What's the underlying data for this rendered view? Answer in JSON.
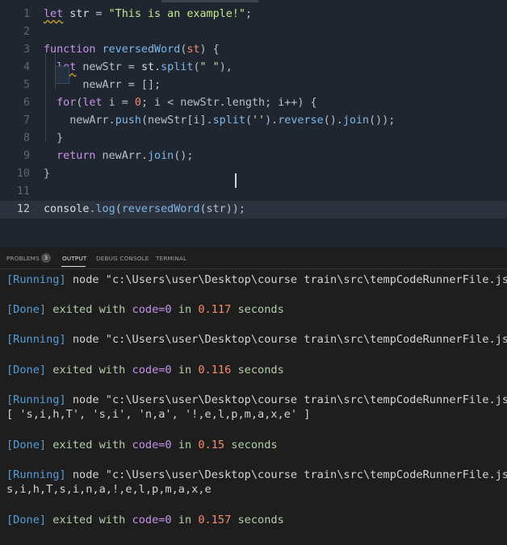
{
  "editor": {
    "lines": [
      {
        "no": "1",
        "tokens": [
          [
            "kw",
            "let"
          ],
          [
            "id",
            " "
          ],
          [
            "id",
            "str"
          ],
          [
            "pc",
            " = "
          ],
          [
            "str",
            "\"This is an example!\""
          ],
          [
            "pc",
            ";"
          ]
        ]
      },
      {
        "no": "2",
        "tokens": []
      },
      {
        "no": "3",
        "tokens": [
          [
            "kw",
            "function"
          ],
          [
            "pc",
            " "
          ],
          [
            "fn",
            "reversedWord"
          ],
          [
            "pc",
            "("
          ],
          [
            "num",
            "st"
          ],
          [
            "pc",
            ") {"
          ]
        ]
      },
      {
        "no": "4",
        "tokens": [
          [
            "pc",
            "  "
          ],
          [
            "kw",
            "let"
          ],
          [
            "pc",
            " newStr = "
          ],
          [
            "id",
            "st"
          ],
          [
            "pc",
            "."
          ],
          [
            "fn",
            "split"
          ],
          [
            "pc",
            "("
          ],
          [
            "str",
            "\" \""
          ],
          [
            "pc",
            "),"
          ]
        ]
      },
      {
        "no": "5",
        "tokens": [
          [
            "pc",
            "      newArr = [];"
          ]
        ]
      },
      {
        "no": "6",
        "tokens": [
          [
            "pc",
            "  "
          ],
          [
            "kw",
            "for"
          ],
          [
            "pc",
            "("
          ],
          [
            "kw",
            "let"
          ],
          [
            "pc",
            " i = "
          ],
          [
            "num",
            "0"
          ],
          [
            "pc",
            "; i < newStr.length; i++) {"
          ]
        ]
      },
      {
        "no": "7",
        "tokens": [
          [
            "pc",
            "    newArr."
          ],
          [
            "fn",
            "push"
          ],
          [
            "pc",
            "(newStr[i]."
          ],
          [
            "fn",
            "split"
          ],
          [
            "pc",
            "("
          ],
          [
            "str",
            "''"
          ],
          [
            "pc",
            ")."
          ],
          [
            "fn",
            "reverse"
          ],
          [
            "pc",
            "()."
          ],
          [
            "fn",
            "join"
          ],
          [
            "pc",
            "());"
          ]
        ]
      },
      {
        "no": "8",
        "tokens": [
          [
            "pc",
            "  }"
          ]
        ]
      },
      {
        "no": "9",
        "tokens": [
          [
            "pc",
            "  "
          ],
          [
            "kw",
            "return"
          ],
          [
            "pc",
            " newArr."
          ],
          [
            "fn",
            "join"
          ],
          [
            "pc",
            "();"
          ]
        ]
      },
      {
        "no": "10",
        "tokens": [
          [
            "pc",
            "}"
          ]
        ]
      },
      {
        "no": "11",
        "tokens": []
      },
      {
        "no": "12",
        "tokens": [
          [
            "id",
            "console"
          ],
          [
            "pc",
            "."
          ],
          [
            "fn",
            "log"
          ],
          [
            "pc",
            "("
          ],
          [
            "fn",
            "reversedWord"
          ],
          [
            "pc",
            "(str));"
          ]
        ]
      }
    ]
  },
  "panel": {
    "tabs": [
      {
        "label": "PROBLEMS",
        "badge": "3"
      },
      {
        "label": "OUTPUT"
      },
      {
        "label": "DEBUG CONSOLE"
      },
      {
        "label": "TERMINAL"
      }
    ],
    "output": [
      {
        "kind": "running",
        "prefix": "[Running]",
        "text": " node \"c:\\Users\\user\\Desktop\\course train\\src\\tempCodeRunnerFile.js\""
      },
      {
        "kind": "blank"
      },
      {
        "kind": "done",
        "prefix": "[Done]",
        "a": " exited with ",
        "code": "code=0",
        "b": " in ",
        "secs": "0.117",
        "c": " seconds"
      },
      {
        "kind": "blank"
      },
      {
        "kind": "running",
        "prefix": "[Running]",
        "text": " node \"c:\\Users\\user\\Desktop\\course train\\src\\tempCodeRunnerFile.js\""
      },
      {
        "kind": "blank"
      },
      {
        "kind": "done",
        "prefix": "[Done]",
        "a": " exited with ",
        "code": "code=0",
        "b": " in ",
        "secs": "0.116",
        "c": " seconds"
      },
      {
        "kind": "blank"
      },
      {
        "kind": "running",
        "prefix": "[Running]",
        "text": " node \"c:\\Users\\user\\Desktop\\course train\\src\\tempCodeRunnerFile.js\""
      },
      {
        "kind": "plain",
        "text": "[ 's,i,h,T', 's,i', 'n,a', '!,e,l,p,m,a,x,e' ]"
      },
      {
        "kind": "blank"
      },
      {
        "kind": "done",
        "prefix": "[Done]",
        "a": " exited with ",
        "code": "code=0",
        "b": " in ",
        "secs": "0.15",
        "c": " seconds"
      },
      {
        "kind": "blank"
      },
      {
        "kind": "running",
        "prefix": "[Running]",
        "text": " node \"c:\\Users\\user\\Desktop\\course train\\src\\tempCodeRunnerFile.js\""
      },
      {
        "kind": "plain",
        "text": "s,i,h,T,s,i,n,a,!,e,l,p,m,a,x,e"
      },
      {
        "kind": "blank"
      },
      {
        "kind": "done",
        "prefix": "[Done]",
        "a": " exited with ",
        "code": "code=0",
        "b": " in ",
        "secs": "0.157",
        "c": " seconds"
      }
    ]
  }
}
